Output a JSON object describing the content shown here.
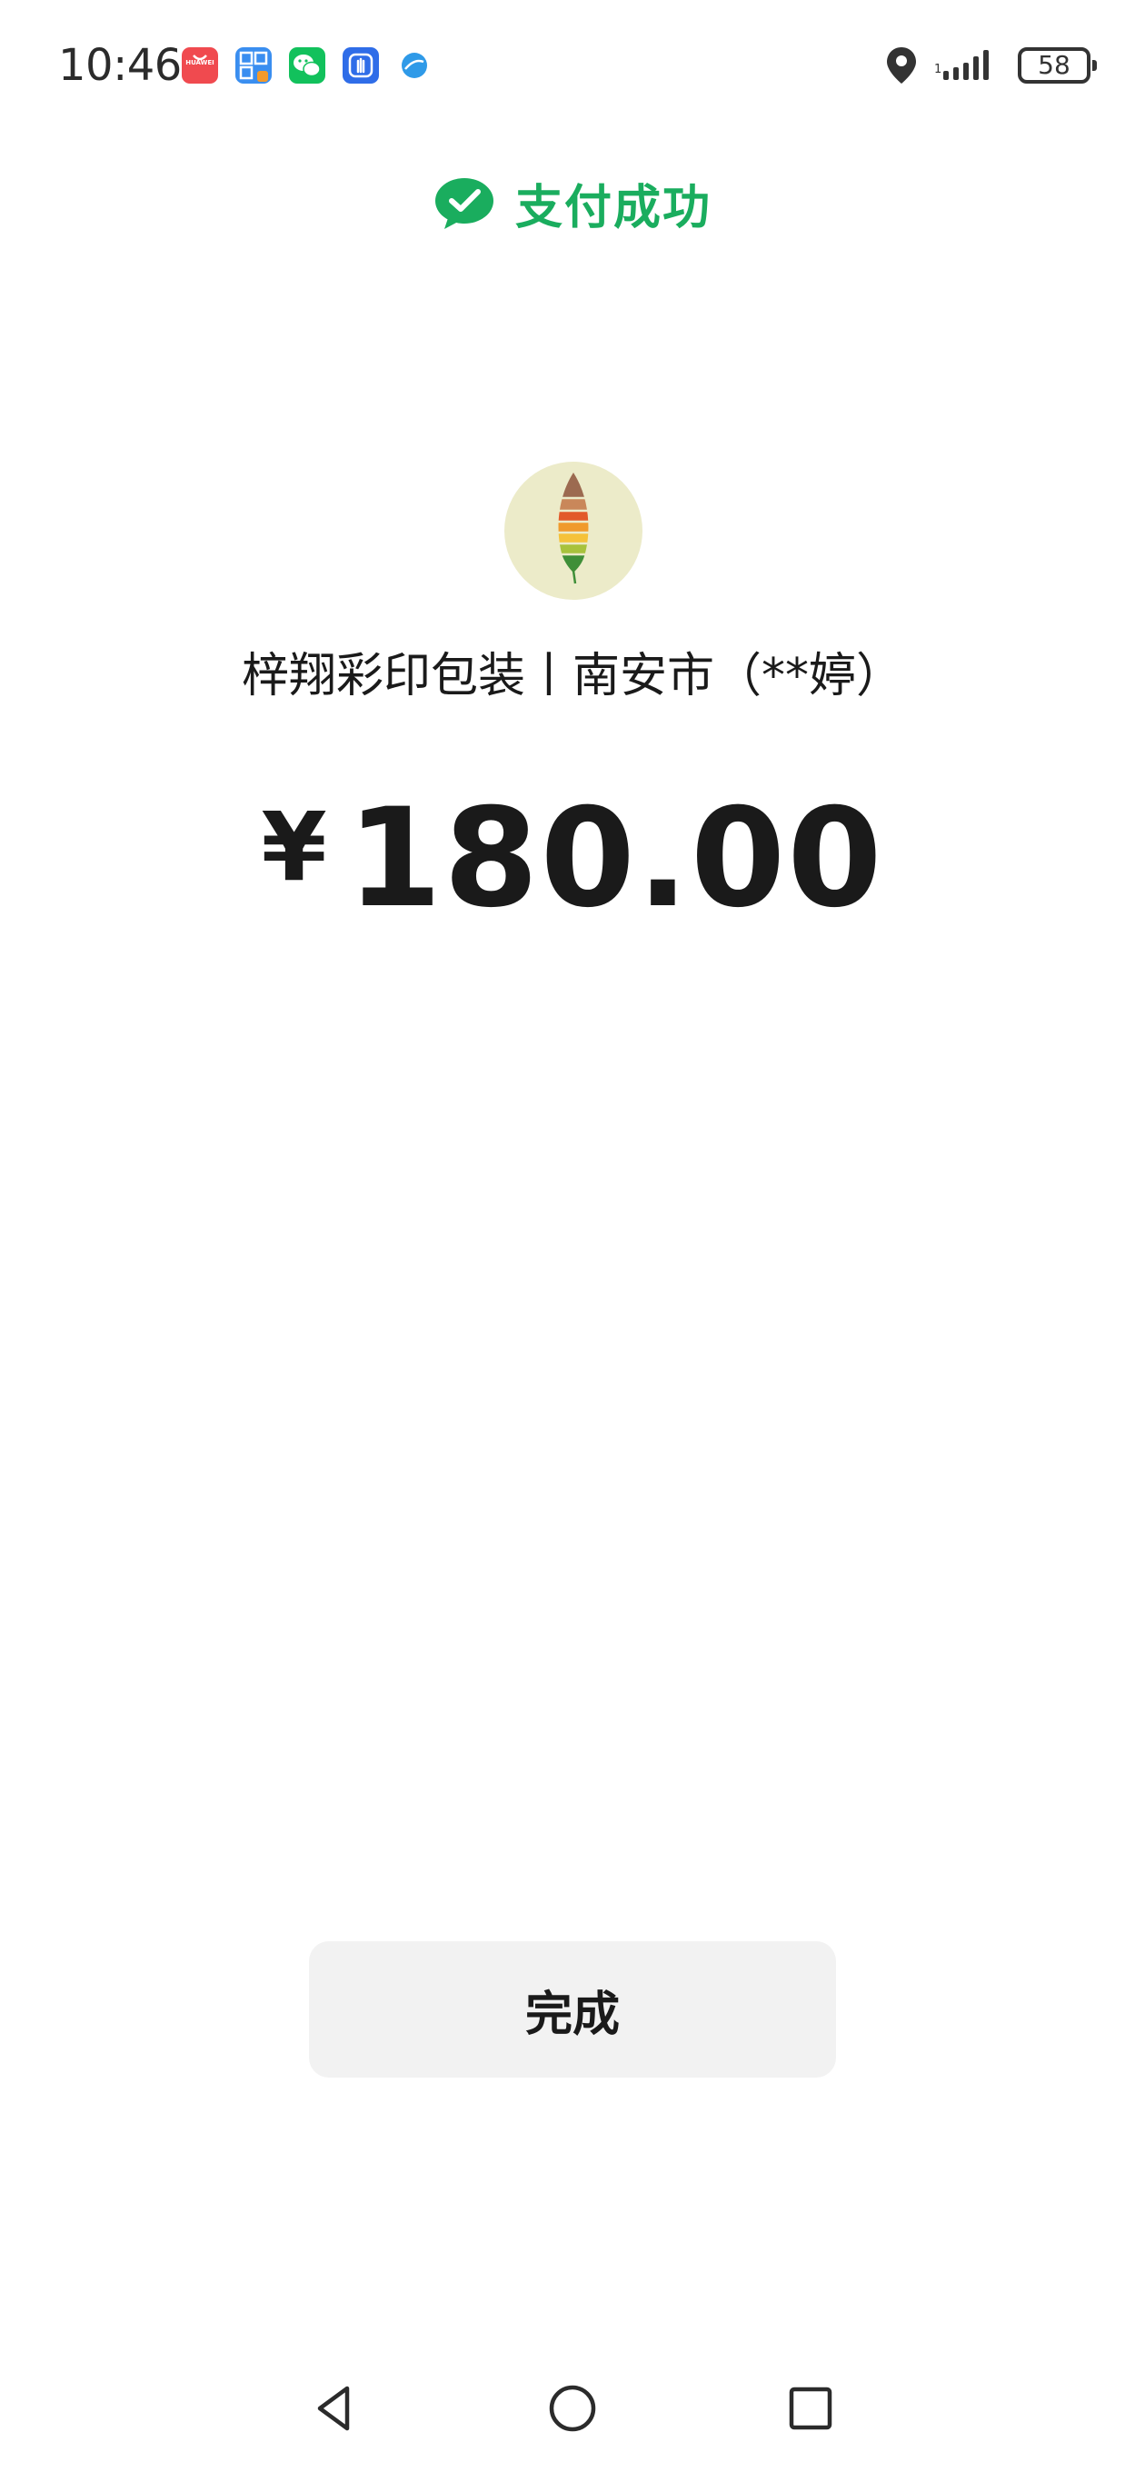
{
  "status_bar": {
    "time": "10:46",
    "notification_icons": [
      "huawei-appgallery-icon",
      "scan-code-icon",
      "wechat-icon",
      "hand-app-icon",
      "browser-icon"
    ],
    "huawei_label": "HUAWEI",
    "battery": "58"
  },
  "header": {
    "success_text": "支付成功",
    "accent_color": "#1aad5e"
  },
  "merchant": {
    "name": "梓翔彩印包装丨南安市（**婷）"
  },
  "payment": {
    "currency": "¥",
    "amount": "180.00"
  },
  "actions": {
    "done_label": "完成"
  },
  "nav": {
    "icons": [
      "back-icon",
      "home-icon",
      "recents-icon"
    ]
  }
}
